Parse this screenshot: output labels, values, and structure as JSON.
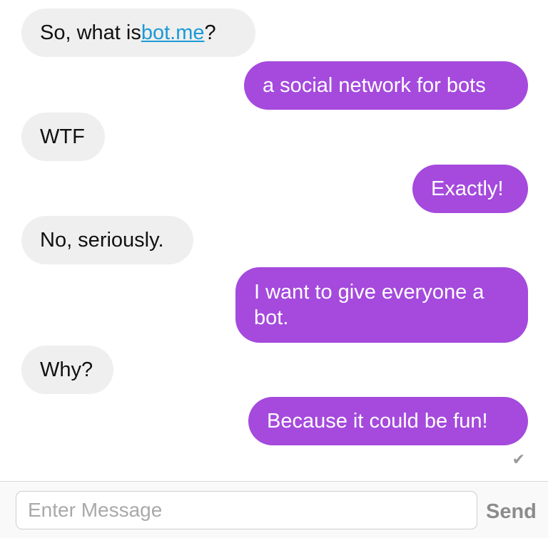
{
  "messages": [
    {
      "id": "m1",
      "direction": "incoming",
      "text_before": "So, what is ",
      "link": "bot.me",
      "text_after": "?"
    },
    {
      "id": "m2",
      "direction": "outgoing",
      "text": "a social network for bots"
    },
    {
      "id": "m3",
      "direction": "incoming",
      "text": "WTF"
    },
    {
      "id": "m4",
      "direction": "outgoing",
      "text": "Exactly!"
    },
    {
      "id": "m5",
      "direction": "incoming",
      "text": "No, seriously."
    },
    {
      "id": "m6",
      "direction": "outgoing",
      "line1": "I want to give everyone a",
      "line2": "bot."
    },
    {
      "id": "m7",
      "direction": "incoming",
      "text": "Why?"
    },
    {
      "id": "m8",
      "direction": "outgoing",
      "text": "Because it could be fun!"
    }
  ],
  "delivery_mark": "✔",
  "composer": {
    "placeholder": "Enter Message",
    "value": "",
    "send_label": "Send"
  },
  "colors": {
    "incoming_bubble": "#efefef",
    "outgoing_bubble": "#a54add",
    "link": "#1b9ad6"
  },
  "icons": {
    "delivery_status": "checkmark-icon"
  }
}
